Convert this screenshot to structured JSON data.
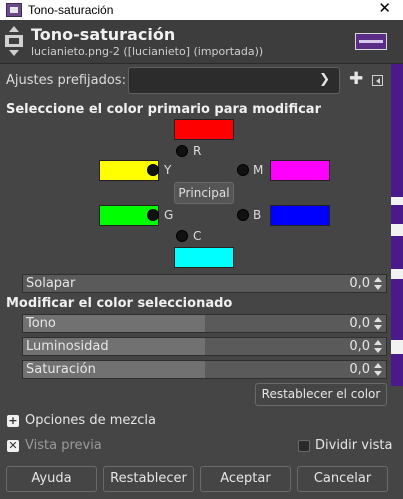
{
  "window": {
    "title": "Tono-saturación",
    "close_glyph": "✕"
  },
  "header": {
    "title": "Tono-saturación",
    "subtitle": "lucianieto.png-2 ([lucianieto] (importada))",
    "tool_icon": "hue-saturation-icon",
    "thumbnail_icon": "image-thumbnail-icon"
  },
  "presets": {
    "label": "Ajustes prefijados:",
    "value": "",
    "add_glyph": "✚"
  },
  "primary": {
    "heading": "Seleccione el color primario para modificar",
    "principal_label": "Principal",
    "colors": [
      {
        "key": "R",
        "label": "R",
        "color": "#ff0000"
      },
      {
        "key": "Y",
        "label": "Y",
        "color": "#ffff00"
      },
      {
        "key": "M",
        "label": "M",
        "color": "#ff00ff"
      },
      {
        "key": "G",
        "label": "G",
        "color": "#00ff00"
      },
      {
        "key": "B",
        "label": "B",
        "color": "#0000ff"
      },
      {
        "key": "C",
        "label": "C",
        "color": "#00ffff"
      }
    ]
  },
  "overlap": {
    "label": "Solapar",
    "value": "0,0",
    "level": 0.0
  },
  "modify": {
    "heading": "Modificar el color seleccionado",
    "tono": {
      "label": "Tono",
      "value": "0,0",
      "level": 0.5
    },
    "luminosidad": {
      "label": "Luminosidad",
      "value": "0,0",
      "level": 0.5
    },
    "saturacion": {
      "label": "Saturación",
      "value": "0,0",
      "level": 0.5
    },
    "reset_label": "Restablecer el color"
  },
  "blend": {
    "label": "Opciones de mezcla"
  },
  "preview": {
    "label": "Vista previa",
    "checked": true,
    "split_label": "Dividir vista",
    "split_checked": false
  },
  "buttons": {
    "help": "Ayuda",
    "reset": "Restablecer",
    "ok": "Aceptar",
    "cancel": "Cancelar"
  },
  "colors": {
    "panel_bg": "#454545",
    "header_bg": "#3d3d3d",
    "image_edge": "#4b1a8a"
  }
}
